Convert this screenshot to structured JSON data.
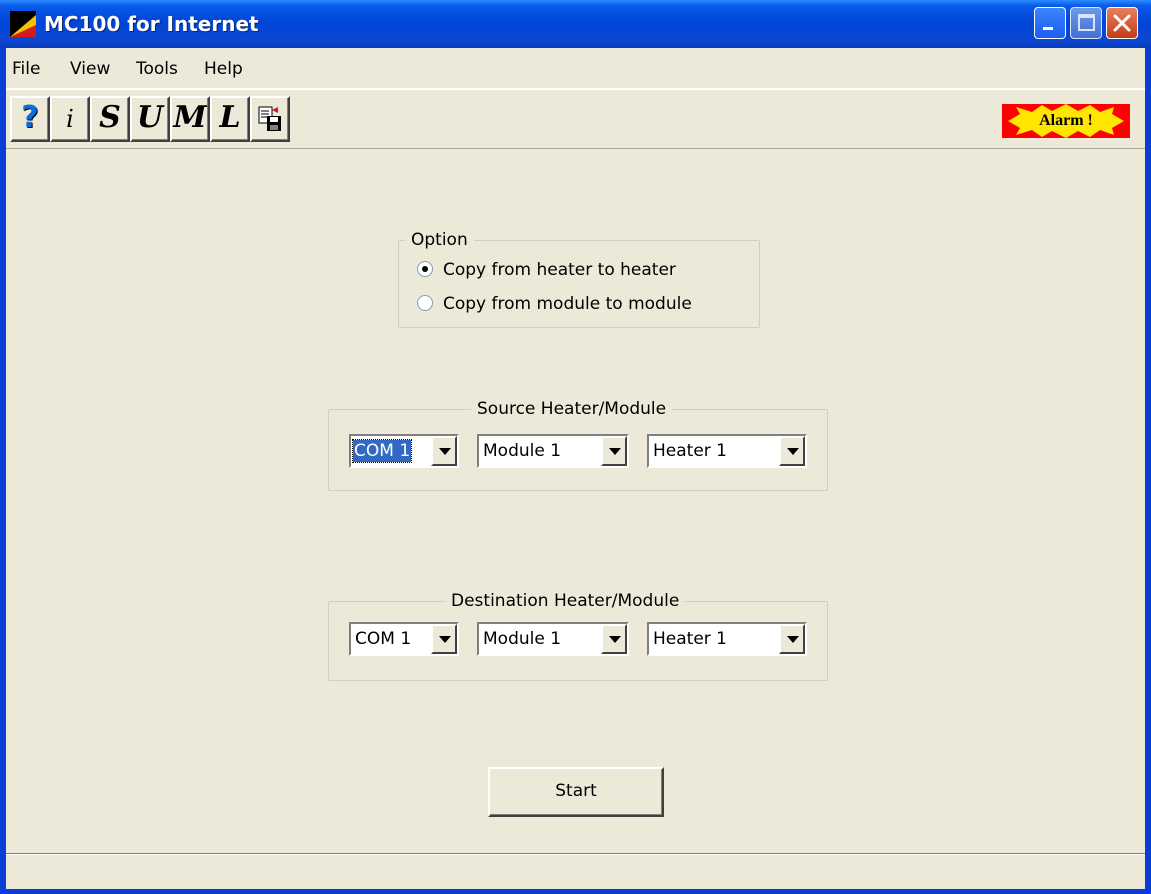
{
  "window": {
    "title": "MC100 for Internet",
    "colors": {
      "titlebar": "#0046d8",
      "close_button": "#c53a17",
      "face": "#ece9d8"
    }
  },
  "menu": {
    "items": [
      "File",
      "View",
      "Tools",
      "Help"
    ]
  },
  "toolbar": {
    "buttons": [
      {
        "icon": "help-question-icon",
        "glyph": "?"
      },
      {
        "icon": "info-icon",
        "glyph": "i"
      },
      {
        "icon": "s-icon",
        "glyph": "S"
      },
      {
        "icon": "u-icon",
        "glyph": "U"
      },
      {
        "icon": "m-icon",
        "glyph": "M"
      },
      {
        "icon": "l-icon",
        "glyph": "L"
      },
      {
        "icon": "copy-save-icon",
        "glyph": ""
      }
    ],
    "alarm_label": "Alarm !",
    "alarm_color": "#ff0000"
  },
  "option_group": {
    "label": "Option",
    "options": [
      {
        "label": "Copy from heater to heater",
        "selected": true
      },
      {
        "label": "Copy from module to module",
        "selected": false
      }
    ]
  },
  "source_group": {
    "label": "Source Heater/Module",
    "port": "COM 1",
    "module": "Module 1",
    "heater": "Heater 1"
  },
  "destination_group": {
    "label": "Destination Heater/Module",
    "port": "COM 1",
    "module": "Module 1",
    "heater": "Heater 1"
  },
  "actions": {
    "start_label": "Start"
  }
}
